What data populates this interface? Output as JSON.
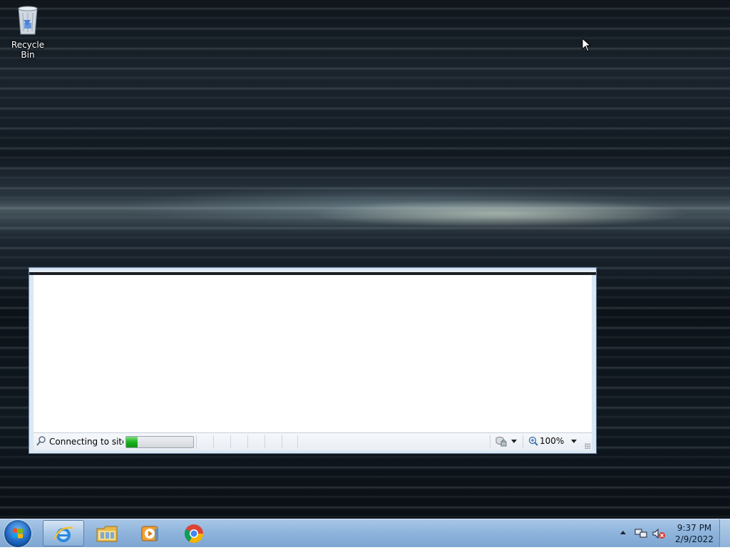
{
  "desktop": {
    "icons": [
      {
        "label": "Recycle Bin",
        "icon": "recycle-bin-icon"
      }
    ]
  },
  "ie_window": {
    "status": {
      "text": "Connecting to site ...",
      "progress": 0.17,
      "zoom": "100%"
    }
  },
  "taskbar": {
    "pinned": [
      {
        "name": "Internet Explorer",
        "icon": "internet-explorer-icon",
        "active": true
      },
      {
        "name": "Windows Explorer",
        "icon": "folder-icon",
        "active": false
      },
      {
        "name": "Windows Media Player",
        "icon": "media-player-icon",
        "active": false
      },
      {
        "name": "Google Chrome",
        "icon": "chrome-icon",
        "active": false
      }
    ],
    "clock": {
      "time": "9:37 PM",
      "date": "2/9/2022"
    }
  },
  "colors": {
    "taskbar": "#90b5dc",
    "progress_fill": "#18b31c",
    "window_frame": "#dbe8f4"
  }
}
